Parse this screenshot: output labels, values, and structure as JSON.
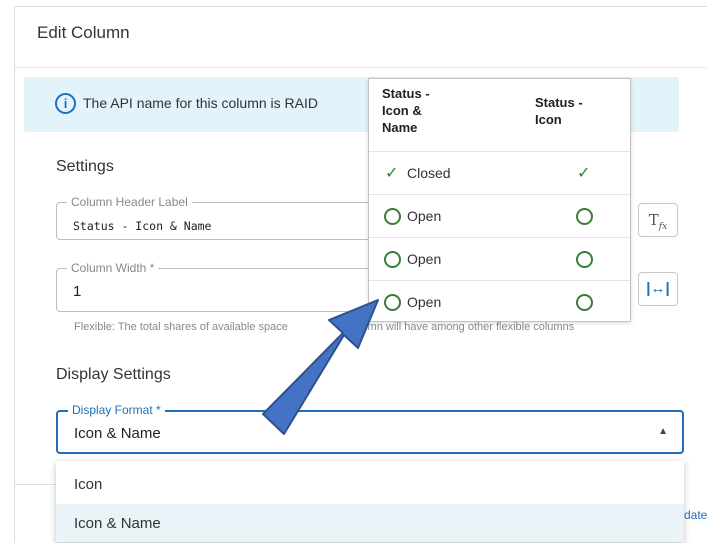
{
  "dialog": {
    "title": "Edit Column",
    "info": "The API name for this column is RAID",
    "settings_title": "Settings",
    "header_label": {
      "label": "Column Header Label",
      "value": "Status - Icon & Name"
    },
    "width": {
      "label": "Column Width *",
      "value": "1"
    },
    "helper_text": "Flexible: The total shares of available space",
    "helper_text_tail": "olumn will have among other flexible columns",
    "display_settings_title": "Display Settings",
    "display_format": {
      "label": "Display Format *",
      "value": "Icon & Name"
    },
    "options": [
      "Icon",
      "Icon & Name"
    ],
    "footer_cut": "date"
  },
  "popover": {
    "headers": {
      "col1": [
        "Status -",
        "Icon &",
        "Name"
      ],
      "col2": [
        "Status -",
        "Icon"
      ]
    },
    "rows": [
      {
        "label": "Closed",
        "icon": "check-icon"
      },
      {
        "label": "Open",
        "icon": "circle-icon"
      },
      {
        "label": "Open",
        "icon": "circle-icon"
      },
      {
        "label": "Open",
        "icon": "circle-icon"
      }
    ]
  },
  "colors": {
    "accent": "#1f6fb8",
    "status_green": "#3a7d3a",
    "arrow": "#4472c4",
    "banner": "#e2f3fb"
  },
  "icons": {
    "info": "info-icon",
    "fx": "formula-icon",
    "width": "fit-width-icon",
    "caret": "caret-up-icon"
  }
}
